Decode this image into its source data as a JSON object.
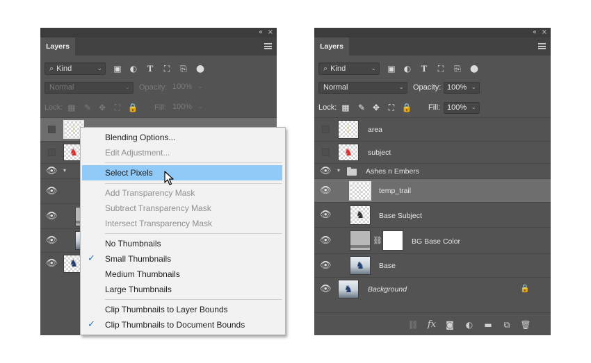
{
  "left_panel": {
    "tab_label": "Layers",
    "collapse_glyph": "«",
    "close_glyph": "×",
    "filter_kind": "Kind",
    "blend_mode": "Normal",
    "opacity_label": "Opacity:",
    "opacity_value": "100%",
    "lock_label": "Lock:",
    "fill_label": "Fill:",
    "fill_value": "100%"
  },
  "context_menu": {
    "items": [
      {
        "label": "Blending Options...",
        "state": "enabled"
      },
      {
        "label": "Edit Adjustment...",
        "state": "disabled"
      },
      {
        "label": "Select Pixels",
        "state": "hover"
      },
      {
        "label": "Add Transparency Mask",
        "state": "disabled"
      },
      {
        "label": "Subtract Transparency Mask",
        "state": "disabled"
      },
      {
        "label": "Intersect Transparency Mask",
        "state": "disabled"
      },
      {
        "label": "No Thumbnails",
        "state": "enabled"
      },
      {
        "label": "Small Thumbnails",
        "state": "checked"
      },
      {
        "label": "Medium Thumbnails",
        "state": "enabled"
      },
      {
        "label": "Large Thumbnails",
        "state": "enabled"
      },
      {
        "label": "Clip Thumbnails to Layer Bounds",
        "state": "enabled"
      },
      {
        "label": "Clip Thumbnails to Document Bounds",
        "state": "checked"
      }
    ]
  },
  "right_panel": {
    "tab_label": "Layers",
    "collapse_glyph": "«",
    "close_glyph": "×",
    "filter_kind": "Kind",
    "blend_mode": "Normal",
    "opacity_label": "Opacity:",
    "opacity_value": "100%",
    "lock_label": "Lock:",
    "fill_label": "Fill:",
    "fill_value": "100%",
    "layers": [
      {
        "name": "area",
        "visible": false
      },
      {
        "name": "subject",
        "visible": false
      },
      {
        "name": "Ashes n Embers",
        "visible": true,
        "type": "group"
      },
      {
        "name": "temp_trail",
        "visible": true,
        "selected": true
      },
      {
        "name": "Base Subject",
        "visible": true
      },
      {
        "name": "BG Base Color",
        "visible": true,
        "has_mask": true
      },
      {
        "name": "Base",
        "visible": true
      },
      {
        "name": "Background",
        "visible": true,
        "locked": true
      }
    ],
    "bottom_icons": [
      "link-icon",
      "fx-icon",
      "mask-icon",
      "adjustment-icon",
      "folder-icon",
      "new-layer-icon",
      "trash-icon"
    ]
  },
  "icons": {
    "eye": "👁",
    "search": "⌕",
    "chevron": "⌄",
    "check": "✓",
    "lock": "🔒",
    "chain": "⛓"
  },
  "colors": {
    "panel_bg": "#535353",
    "selected_row": "#6e6e6e",
    "menu_hover": "#91c9f7",
    "menu_check": "#2b6fb8"
  }
}
